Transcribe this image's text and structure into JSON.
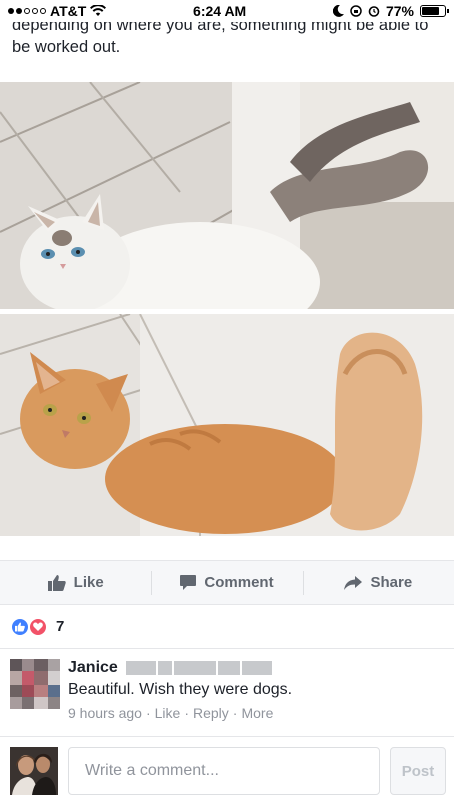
{
  "status_bar": {
    "carrier": "AT&T",
    "time": "6:24 AM",
    "battery": "77%",
    "battery_level": 0.77
  },
  "post": {
    "text": "depending on where you are, something might be able to be worked out."
  },
  "photos": [
    {
      "subject": "white cat"
    },
    {
      "subject": "orange cat"
    }
  ],
  "actions": {
    "like": "Like",
    "comment": "Comment",
    "share": "Share"
  },
  "reactions": {
    "count": "7"
  },
  "comment": {
    "author": "Janice",
    "text": "Beautiful. Wish they were dogs.",
    "time": "9 hours ago",
    "like": "Like",
    "reply": "Reply",
    "more": "More"
  },
  "composer": {
    "placeholder": "Write a comment...",
    "post_label": "Post"
  },
  "colors": {
    "like_blue": "#4080ff",
    "love_red": "#f25268",
    "action_gray": "#616770"
  }
}
